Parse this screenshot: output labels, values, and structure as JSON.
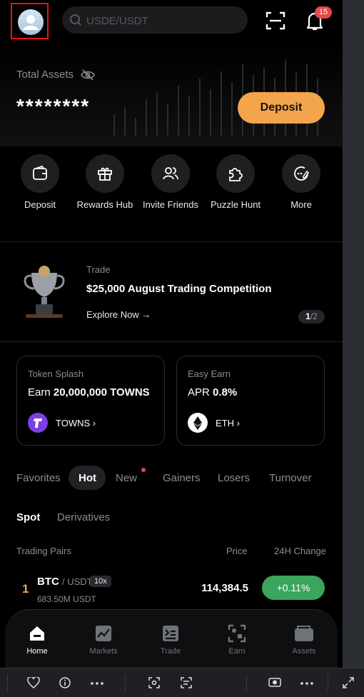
{
  "header": {
    "search_placeholder": "USDE/USDT",
    "notification_count": "15"
  },
  "assets": {
    "label": "Total Assets",
    "value": "********",
    "deposit_label": "Deposit"
  },
  "quick_actions": [
    {
      "label": "Deposit",
      "icon": "wallet-icon"
    },
    {
      "label": "Rewards Hub",
      "icon": "gift-icon"
    },
    {
      "label": "Invite Friends",
      "icon": "friends-icon"
    },
    {
      "label": "Puzzle Hunt",
      "icon": "puzzle-icon"
    },
    {
      "label": "More",
      "icon": "more-icon"
    }
  ],
  "banner": {
    "category": "Trade",
    "title": "$25,000 August Trading Competition",
    "link": "Explore Now",
    "page_current": "1",
    "page_total": "/2"
  },
  "cards": [
    {
      "category": "Token Splash",
      "prefix": "Earn",
      "amount": "20,000,000 TOWNS",
      "coin": "TOWNS",
      "coin_color": "#7b3fe4"
    },
    {
      "category": "Easy Earn",
      "prefix": "APR",
      "amount": "0.8%",
      "coin": "ETH",
      "coin_color": "#ffffff"
    }
  ],
  "market_tabs": [
    "Favorites",
    "Hot",
    "New",
    "Gainers",
    "Losers",
    "Turnover"
  ],
  "active_tab": "Hot",
  "sub_tabs": [
    "Spot",
    "Derivatives"
  ],
  "columns": {
    "pairs": "Trading Pairs",
    "price": "Price",
    "change": "24H Change"
  },
  "rows": [
    {
      "rank": "1",
      "base": "BTC",
      "quote": "/ USDT",
      "leverage": "10x",
      "volume": "683.50M USDT",
      "price": "114,384.5",
      "change": "+0.11%"
    }
  ],
  "bottom_nav": [
    {
      "label": "Home",
      "icon": "home-icon"
    },
    {
      "label": "Markets",
      "icon": "markets-icon"
    },
    {
      "label": "Trade",
      "icon": "trade-icon"
    },
    {
      "label": "Earn",
      "icon": "earn-icon"
    },
    {
      "label": "Assets",
      "icon": "assets-icon"
    }
  ],
  "colors": {
    "accent": "#f2a54a",
    "positive": "#3ba55c",
    "badge": "#e5484d"
  }
}
